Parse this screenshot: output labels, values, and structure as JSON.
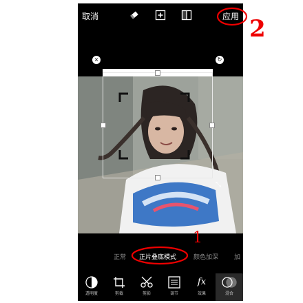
{
  "topbar": {
    "cancel_label": "取消",
    "apply_label": "应用",
    "icons": [
      "eraser-icon",
      "add-layer-icon",
      "compare-icon"
    ]
  },
  "editor": {
    "close_icon": "×",
    "rotate_icon": "↻",
    "resize_icon": "⤡"
  },
  "blend_modes": {
    "items": [
      "正常",
      "正片叠底模式",
      "颜色加深",
      "加"
    ],
    "selected": "正片叠底模式"
  },
  "toolbar": {
    "items": [
      {
        "icon": "opacity-icon",
        "label": "透明度"
      },
      {
        "icon": "crop-icon",
        "label": "剪裁"
      },
      {
        "icon": "cutout-icon",
        "label": "剪影"
      },
      {
        "icon": "adjust-icon",
        "label": "调节"
      },
      {
        "icon": "effects-icon",
        "label": "效果"
      },
      {
        "icon": "blend-icon",
        "label": "混合"
      }
    ],
    "effects_glyph": "fx"
  },
  "annotations": {
    "step_1": "1",
    "step_2": "2"
  },
  "colors": {
    "annotation": "#e00000",
    "app_background": "#000000"
  }
}
